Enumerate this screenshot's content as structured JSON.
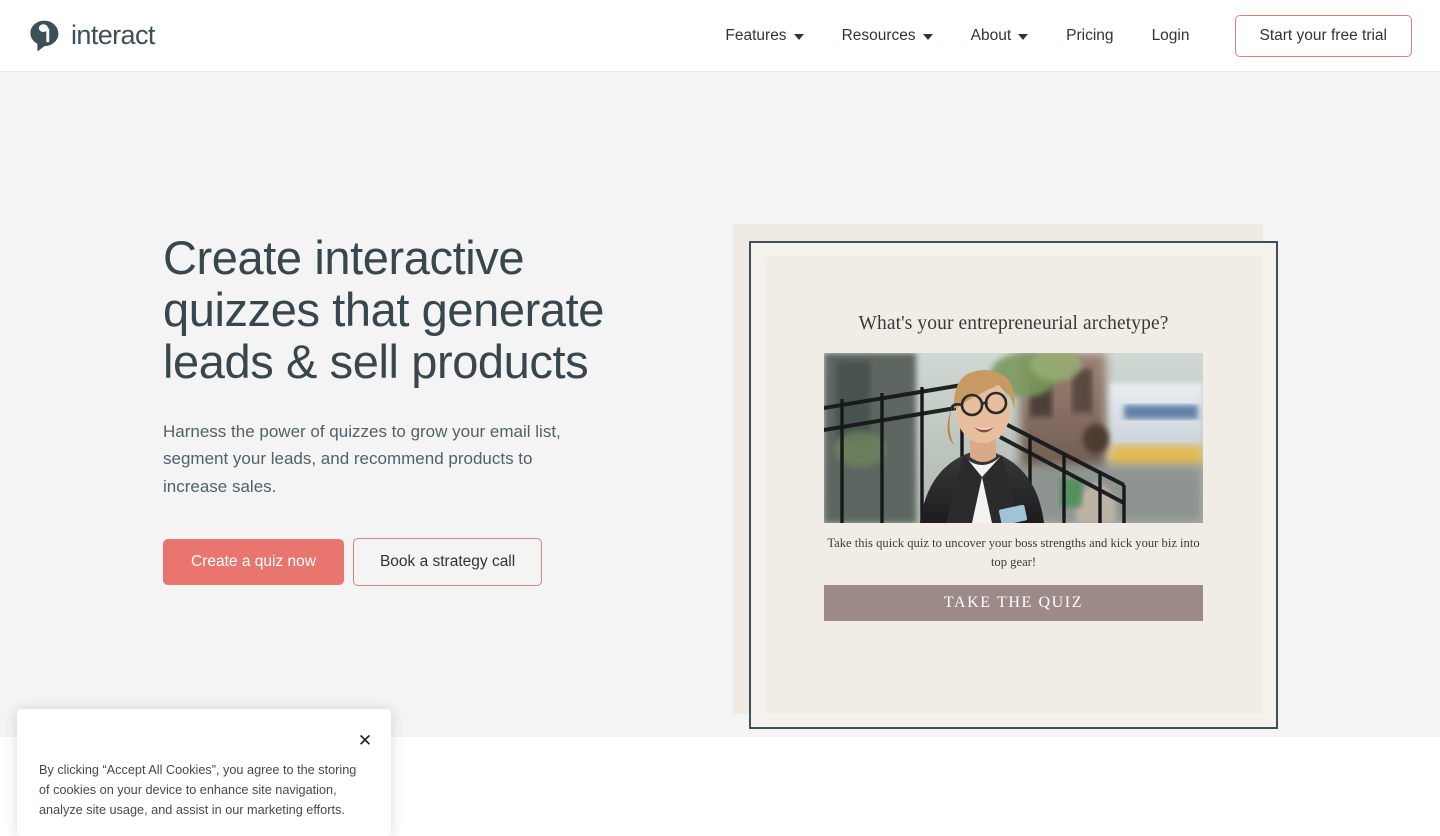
{
  "brand": {
    "name": "interact",
    "logo_icon": "interact-speech-bubble-logo",
    "logo_color": "#3c5057"
  },
  "nav": {
    "items": [
      {
        "label": "Features",
        "has_dropdown": true
      },
      {
        "label": "Resources",
        "has_dropdown": true
      },
      {
        "label": "About",
        "has_dropdown": true
      },
      {
        "label": "Pricing",
        "has_dropdown": false
      },
      {
        "label": "Login",
        "has_dropdown": false
      }
    ],
    "cta_label": "Start your free trial"
  },
  "hero": {
    "title": "Create interactive quizzes that generate leads & sell products",
    "subtitle": "Harness the power of quizzes to grow your email list, segment your leads, and recommend products to increase sales.",
    "primary_button": "Create a quiz now",
    "secondary_button": "Book a strategy call",
    "background_color": "#f3f4f3"
  },
  "quiz_preview": {
    "title": "What's your entrepreneurial archetype?",
    "description": "Take this quick quiz to uncover your boss strengths and kick your biz into top gear!",
    "cta_label": "TAKE THE QUIZ",
    "cta_color": "#9c8a88",
    "card_background": "#f2ece6",
    "frame_color": "#3e5159",
    "photo_alt": "Smiling woman in leather jacket and round glasses standing on city brownstone steps"
  },
  "cookie_banner": {
    "message": "By clicking “Accept All Cookies”, you agree to the storing of cookies on your device to enhance site navigation, analyze site usage, and assist in our marketing efforts.",
    "close_label": "✕"
  },
  "theme": {
    "accent_coral": "#e8766e",
    "accent_coral_border": "#e0827c",
    "text_dark": "#2e3538",
    "heading_color": "#37474d"
  }
}
